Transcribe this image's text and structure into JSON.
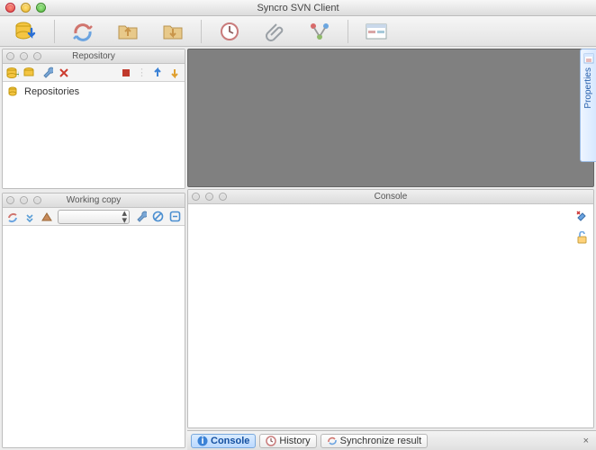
{
  "window": {
    "title": "Syncro SVN Client"
  },
  "repository_panel": {
    "title": "Repository",
    "tree": {
      "root_label": "Repositories"
    }
  },
  "working_copy_panel": {
    "title": "Working copy",
    "selector_value": ""
  },
  "console_panel": {
    "title": "Console"
  },
  "bottom_tabs": {
    "console": "Console",
    "history": "History",
    "sync": "Synchronize result"
  },
  "side_tab": {
    "label": "Properties"
  }
}
